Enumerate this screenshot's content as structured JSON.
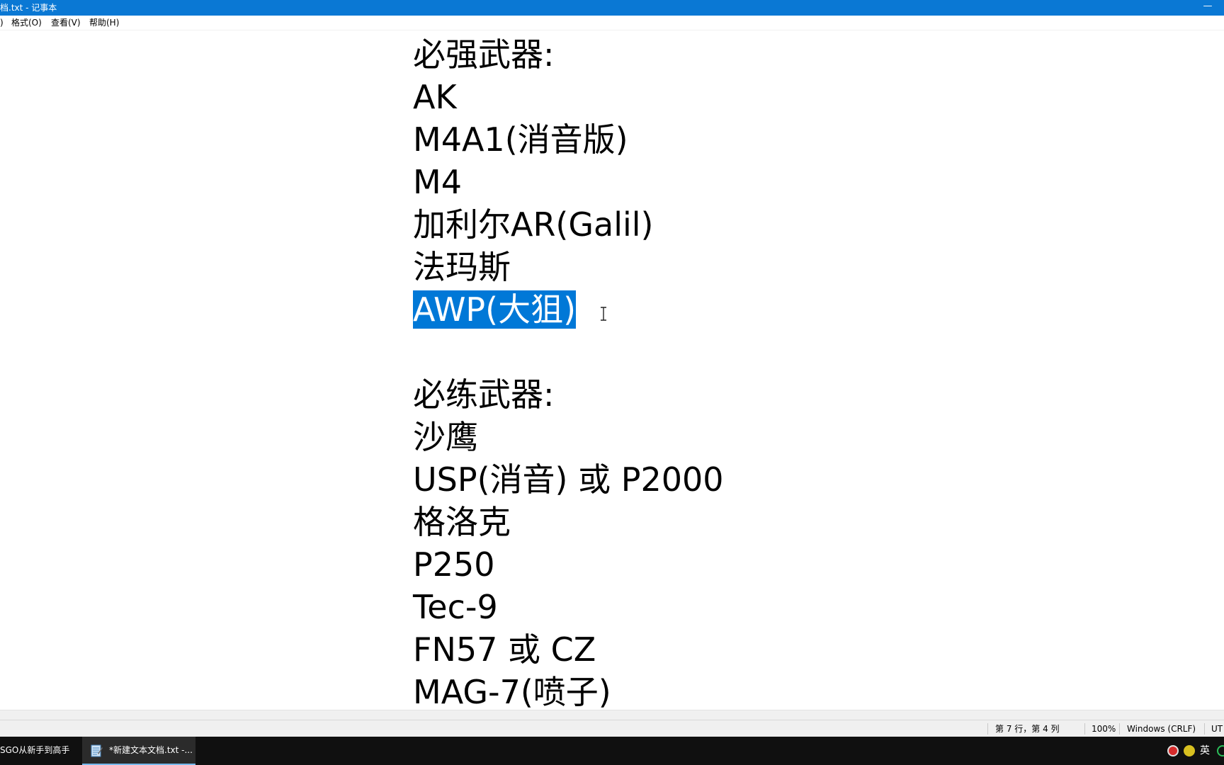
{
  "window": {
    "title": "档.txt - 记事本",
    "minimize_glyph": "—"
  },
  "menu": {
    "items": [
      {
        "label": ")"
      },
      {
        "label": "格式(O)"
      },
      {
        "label": "查看(V)"
      },
      {
        "label": "帮助(H)"
      }
    ]
  },
  "editor": {
    "lines": [
      "必强武器:",
      "AK",
      "M4A1(消音版)",
      "M4",
      "加利尔AR(Galil)",
      "法玛斯",
      "AWP(大狙)",
      "",
      "必练武器:",
      "沙鹰",
      "USP(消音) 或 P2000",
      "格洛克",
      "P250",
      "Tec-9",
      "FN57 或 CZ",
      "MAG-7(喷子)"
    ],
    "selected_line_index": 6,
    "selection_color": "#0078d7"
  },
  "status": {
    "position": "第 7 行，第 4 列",
    "zoom": "100%",
    "line_ending": "Windows (CRLF)",
    "encoding": "UT"
  },
  "taskbar": {
    "tasks": [
      {
        "label": "SGO从新手到高手",
        "active": false
      },
      {
        "label": "*新建文本文档.txt -...",
        "active": true,
        "icon": "notepad-icon"
      }
    ],
    "tray": {
      "ime_label": "英",
      "icons": [
        "record-icon",
        "add-icon",
        "status-icon"
      ]
    }
  },
  "colors": {
    "titlebar": "#0a78d4",
    "taskbar": "#101010",
    "statusbar": "#f0f0f0"
  }
}
